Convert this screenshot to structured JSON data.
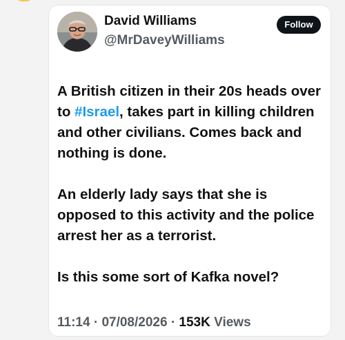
{
  "author": {
    "name": "David Williams",
    "handle": "@MrDaveyWilliams"
  },
  "follow_label": "Follow",
  "tweet": {
    "p1_before": "A British citizen in their 20s heads over to ",
    "p1_hashtag": "#Israel",
    "p1_after": ", takes part in killing children and other civilians. Comes back and nothing is done.",
    "p2": "An elderly lady says that she is opposed to this activity and the police arrest her as a terrorist.",
    "p3": "Is this some sort of Kafka novel?"
  },
  "meta": {
    "time": "11:14",
    "date": "07/08/2026",
    "views_count": "153K",
    "views_label": "Views",
    "separator": "·"
  },
  "colors": {
    "hashtag": "#1d9bf0",
    "follow_bg": "#0f1419"
  }
}
